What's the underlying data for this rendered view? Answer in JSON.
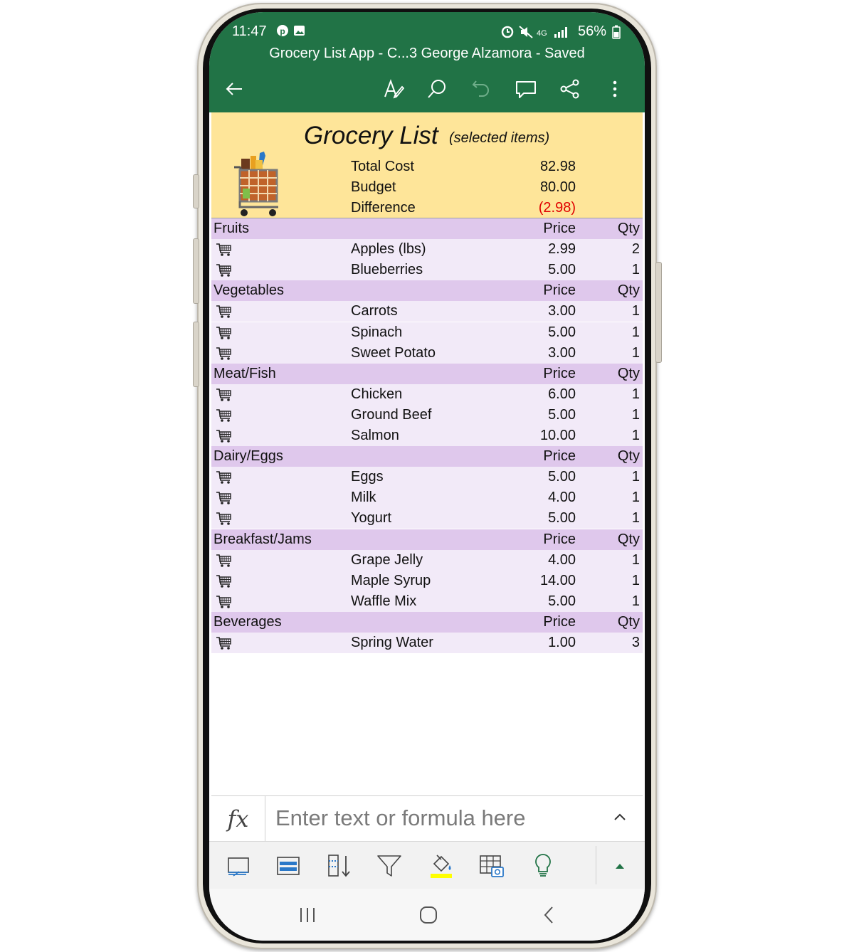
{
  "status_bar": {
    "time": "11:47",
    "battery": "56%"
  },
  "document": {
    "title": "Grocery List App - C...3 George Alzamora  - Saved"
  },
  "toolbar": {
    "icons": [
      "back-arrow-icon",
      "draw-icon",
      "search-icon",
      "undo-icon",
      "comment-icon",
      "share-icon",
      "more-icon"
    ]
  },
  "sheet": {
    "title": "Grocery List",
    "subtitle": "(selected items)",
    "summary": [
      {
        "label": "Total Cost",
        "value": "82.98"
      },
      {
        "label": "Budget",
        "value": "80.00"
      },
      {
        "label": "Difference",
        "value": "(2.98)"
      }
    ],
    "colors": {
      "banner": "#fee599",
      "category_row": "#dfc8ec",
      "item_row": "#f2eaf8",
      "negative": "#e00000",
      "app_header": "#217346"
    },
    "categories": [
      {
        "name": "Fruits",
        "price_header": "Price",
        "qty_header": "Qty",
        "items": [
          {
            "name": "Apples (lbs)",
            "price": "2.99",
            "qty": "2"
          },
          {
            "name": "Blueberries",
            "price": "5.00",
            "qty": "1"
          }
        ]
      },
      {
        "name": "Vegetables",
        "price_header": "Price",
        "qty_header": "Qty",
        "items": [
          {
            "name": "Carrots",
            "price": "3.00",
            "qty": "1"
          },
          {
            "name": "Spinach",
            "price": "5.00",
            "qty": "1"
          },
          {
            "name": "Sweet Potato",
            "price": "3.00",
            "qty": "1"
          }
        ]
      },
      {
        "name": "Meat/Fish",
        "price_header": "Price",
        "qty_header": "Qty",
        "items": [
          {
            "name": "Chicken",
            "price": "6.00",
            "qty": "1"
          },
          {
            "name": "Ground Beef",
            "price": "5.00",
            "qty": "1"
          },
          {
            "name": "Salmon",
            "price": "10.00",
            "qty": "1"
          }
        ]
      },
      {
        "name": "Dairy/Eggs",
        "price_header": "Price",
        "qty_header": "Qty",
        "items": [
          {
            "name": "Eggs",
            "price": "5.00",
            "qty": "1"
          },
          {
            "name": "Milk",
            "price": "4.00",
            "qty": "1"
          },
          {
            "name": "Yogurt",
            "price": "5.00",
            "qty": "1"
          }
        ]
      },
      {
        "name": "Breakfast/Jams",
        "price_header": "Price",
        "qty_header": "Qty",
        "items": [
          {
            "name": "Grape Jelly",
            "price": "4.00",
            "qty": "1"
          },
          {
            "name": "Maple Syrup",
            "price": "14.00",
            "qty": "1"
          },
          {
            "name": "Waffle Mix",
            "price": "5.00",
            "qty": "1"
          }
        ]
      },
      {
        "name": "Beverages",
        "price_header": "Price",
        "qty_header": "Qty",
        "items": [
          {
            "name": "Spring Water",
            "price": "1.00",
            "qty": "3"
          }
        ]
      }
    ]
  },
  "formula_bar": {
    "fx_label": "fx",
    "placeholder": "Enter text or formula here"
  },
  "bottom_toolbar": {
    "icons": [
      "freeze-panes-icon",
      "wrap-text-icon",
      "sort-icon",
      "filter-icon",
      "fill-color-icon",
      "table-picture-icon",
      "tell-me-icon",
      "expand-up-icon"
    ],
    "fill_color": "#ffff00"
  },
  "nav_bar": {
    "icons": [
      "recent-apps-icon",
      "home-icon",
      "back-icon"
    ]
  }
}
